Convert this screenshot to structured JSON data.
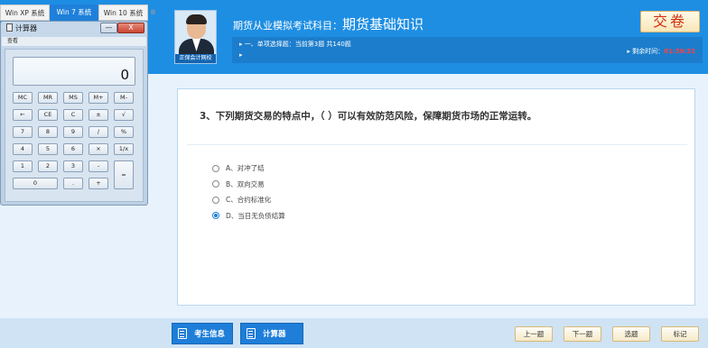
{
  "os_tabs": {
    "xp": "Win XP 系统",
    "w7": "Win 7 系统",
    "w10": "Win 10 系统",
    "close": "⊗"
  },
  "calculator": {
    "title": "计算器",
    "menu": "查看",
    "display": "0",
    "min": "—",
    "close": "X",
    "keys": {
      "mc": "MC",
      "mr": "MR",
      "ms": "MS",
      "mplus": "M+",
      "mminus": "M-",
      "back": "←",
      "ce": "CE",
      "c": "C",
      "plusminus": "±",
      "sqrt": "√",
      "k7": "7",
      "k8": "8",
      "k9": "9",
      "div": "/",
      "pct": "%",
      "k4": "4",
      "k5": "5",
      "k6": "6",
      "mul": "×",
      "recip": "1/x",
      "k1": "1",
      "k2": "2",
      "k3": "3",
      "sub": "-",
      "eq": "=",
      "k0": "0",
      "dot": ".",
      "add": "+"
    }
  },
  "header": {
    "avatar_caption": "正保会计网校",
    "title_prefix": "期货从业模拟考试科目：",
    "subject": "期货基础知识",
    "submit": "交卷",
    "info_line1": "▸ 一、单项选择题：当前第3题 共140题",
    "info_line2": "▸",
    "timer_label": "▸ 剩余时间：",
    "timer_value": "01:39:32"
  },
  "question": {
    "text": "3、下列期货交易的特点中，（   ）可以有效防范风险，保障期货市场的正常运转。",
    "options": [
      {
        "label": "A、对冲了结",
        "selected": false
      },
      {
        "label": "B、双向交易",
        "selected": false
      },
      {
        "label": "C、合约标准化",
        "selected": false
      },
      {
        "label": "D、当日无负债结算",
        "selected": true
      }
    ]
  },
  "footer": {
    "candidate_info": "考生信息",
    "calculator": "计算器",
    "prev": "上一题",
    "next": "下一题",
    "pick": "选题",
    "mark": "标记"
  }
}
